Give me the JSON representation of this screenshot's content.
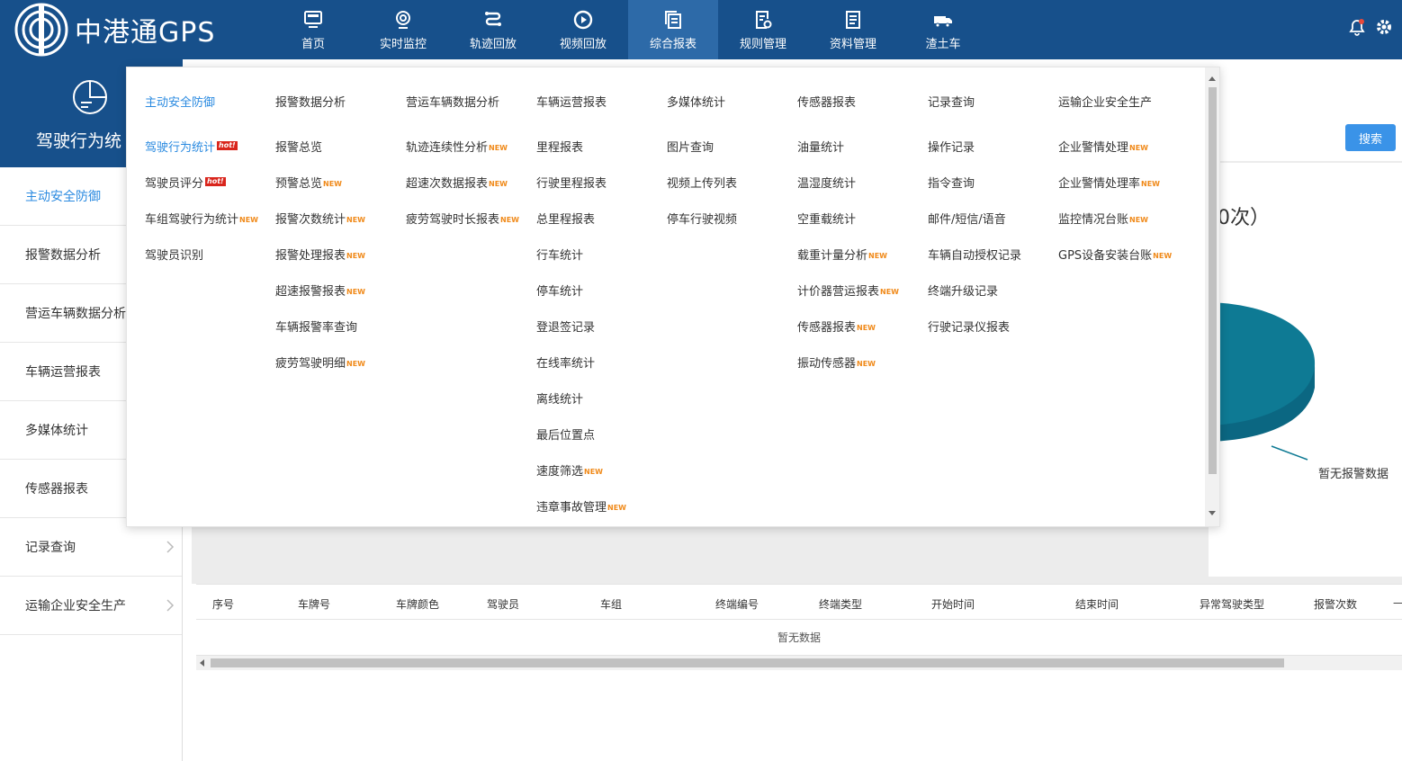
{
  "app": {
    "logo_text": "中港通GPS"
  },
  "nav": [
    {
      "label": "首页",
      "icon": "monitor-icon"
    },
    {
      "label": "实时监控",
      "icon": "webcam-icon"
    },
    {
      "label": "轨迹回放",
      "icon": "route-icon"
    },
    {
      "label": "视频回放",
      "icon": "play-circle-icon"
    },
    {
      "label": "综合报表",
      "icon": "report-copy-icon",
      "active": true
    },
    {
      "label": "规则管理",
      "icon": "rule-settings-icon"
    },
    {
      "label": "资料管理",
      "icon": "document-list-icon"
    },
    {
      "label": "渣土车",
      "icon": "truck-icon"
    }
  ],
  "sidebar": {
    "title": "驾驶行为统",
    "items": [
      {
        "label": "主动安全防御",
        "active": true
      },
      {
        "label": "报警数据分析"
      },
      {
        "label": "营运车辆数据分析"
      },
      {
        "label": "车辆运营报表"
      },
      {
        "label": "多媒体统计"
      },
      {
        "label": "传感器报表"
      },
      {
        "label": "记录查询"
      },
      {
        "label": "运输企业安全生产"
      }
    ]
  },
  "main": {
    "search_label": "搜索",
    "chart_title": "0次）",
    "pie_label": "暂无报警数据",
    "columns": [
      "序号",
      "车牌号",
      "车牌颜色",
      "驾驶员",
      "车组",
      "终端编号",
      "终端类型",
      "开始时间",
      "结束时间",
      "异常驾驶类型",
      "报警次数",
      "—"
    ],
    "empty_text": "暂无数据"
  },
  "menu": {
    "badge_new": "NEW",
    "badge_hot": "hot!",
    "columns": [
      {
        "head": "主动安全防御",
        "active": true,
        "items": [
          {
            "label": "驾驶行为统计",
            "badge": "hot",
            "active": true
          },
          {
            "label": "驾驶员评分",
            "badge": "hot"
          },
          {
            "label": "车组驾驶行为统计",
            "badge": "new"
          },
          {
            "label": "驾驶员识别"
          }
        ]
      },
      {
        "head": "报警数据分析",
        "items": [
          {
            "label": "报警总览"
          },
          {
            "label": "预警总览",
            "badge": "new"
          },
          {
            "label": "报警次数统计",
            "badge": "new"
          },
          {
            "label": "报警处理报表",
            "badge": "new"
          },
          {
            "label": "超速报警报表",
            "badge": "new"
          },
          {
            "label": "车辆报警率查询"
          },
          {
            "label": "疲劳驾驶明细",
            "badge": "new"
          }
        ]
      },
      {
        "head": "营运车辆数据分析",
        "items": [
          {
            "label": "轨迹连续性分析",
            "badge": "new"
          },
          {
            "label": "超速次数据报表",
            "badge": "new"
          },
          {
            "label": "疲劳驾驶时长报表",
            "badge": "new"
          }
        ]
      },
      {
        "head": "车辆运营报表",
        "items": [
          {
            "label": "里程报表"
          },
          {
            "label": "行驶里程报表"
          },
          {
            "label": "总里程报表"
          },
          {
            "label": "行车统计"
          },
          {
            "label": "停车统计"
          },
          {
            "label": "登退签记录"
          },
          {
            "label": "在线率统计"
          },
          {
            "label": "离线统计"
          },
          {
            "label": "最后位置点"
          },
          {
            "label": "速度筛选",
            "badge": "new"
          },
          {
            "label": "违章事故管理",
            "badge": "new"
          }
        ]
      },
      {
        "head": "多媒体统计",
        "items": [
          {
            "label": "图片查询"
          },
          {
            "label": "视频上传列表"
          },
          {
            "label": "停车行驶视频"
          }
        ]
      },
      {
        "head": "传感器报表",
        "items": [
          {
            "label": "油量统计"
          },
          {
            "label": "温湿度统计"
          },
          {
            "label": "空重载统计"
          },
          {
            "label": "载重计量分析",
            "badge": "new"
          },
          {
            "label": "计价器营运报表",
            "badge": "new"
          },
          {
            "label": "传感器报表",
            "badge": "new"
          },
          {
            "label": "振动传感器",
            "badge": "new"
          }
        ]
      },
      {
        "head": "记录查询",
        "items": [
          {
            "label": "操作记录"
          },
          {
            "label": "指令查询"
          },
          {
            "label": "邮件/短信/语音"
          },
          {
            "label": "车辆自动授权记录"
          },
          {
            "label": "终端升级记录"
          },
          {
            "label": "行驶记录仪报表"
          }
        ]
      },
      {
        "head": "运输企业安全生产",
        "items": [
          {
            "label": "企业警情处理",
            "badge": "new"
          },
          {
            "label": "企业警情处理率",
            "badge": "new"
          },
          {
            "label": "监控情况台账",
            "badge": "new"
          },
          {
            "label": "GPS设备安装台账",
            "badge": "new"
          }
        ]
      }
    ]
  },
  "colors": {
    "header": "#17508b",
    "accent": "#2a8ae0",
    "pie": "#0e7a94",
    "new_badge": "#f08a1a",
    "hot_badge": "#d9251c"
  }
}
